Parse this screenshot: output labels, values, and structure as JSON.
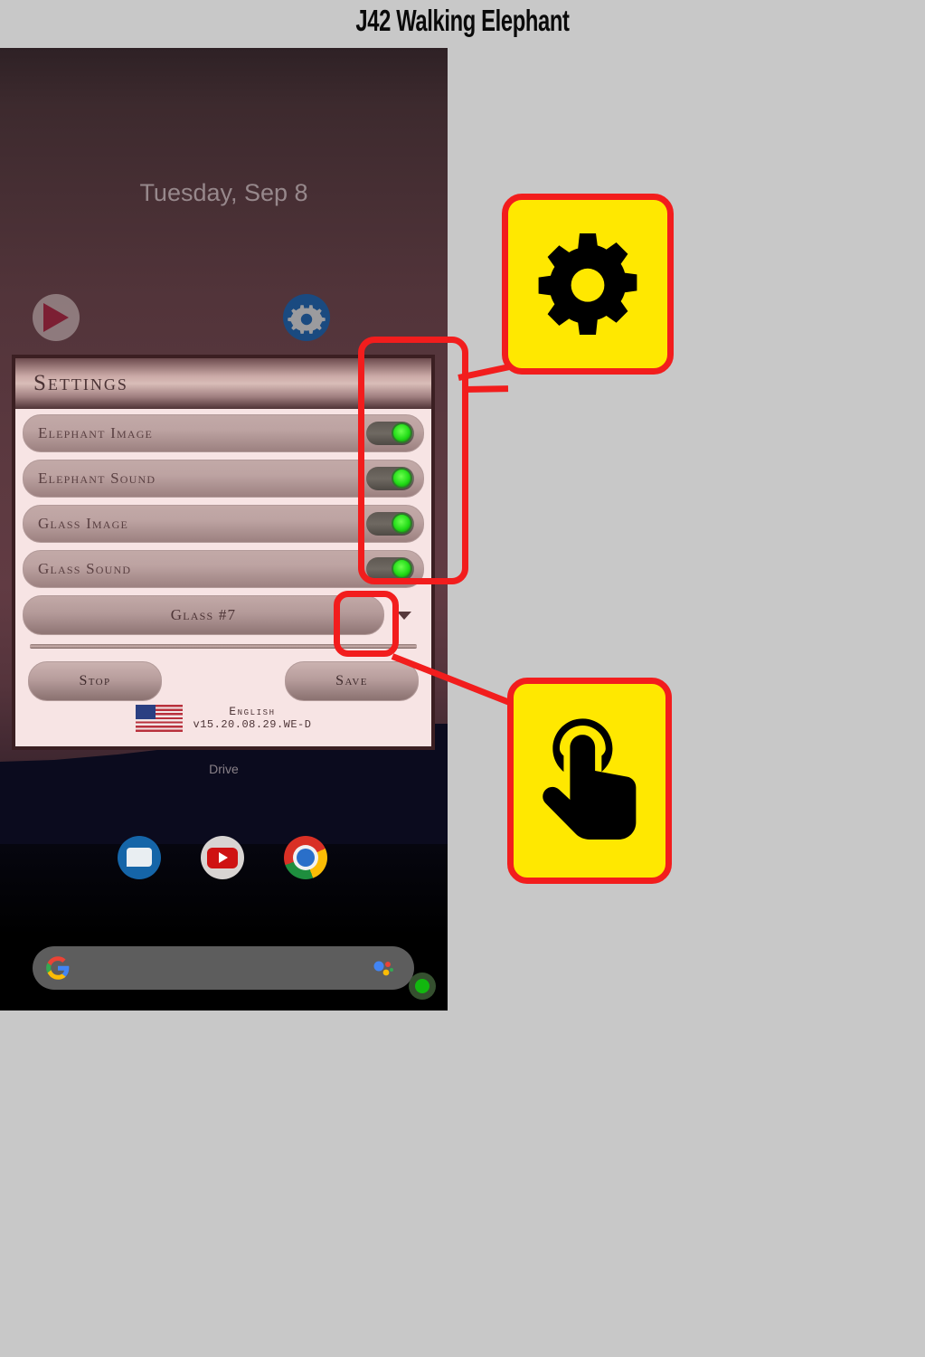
{
  "page": {
    "title": "J42 Walking Elephant",
    "background_color": "#c8c8c8",
    "accent_color": "#f21d1d",
    "callout_fill": "#ffe800"
  },
  "phone": {
    "home_screen": {
      "date": "Tuesday, Sep 8",
      "folder_label": "Drive",
      "icons": [
        {
          "name": "play-movies-icon",
          "label": ""
        },
        {
          "name": "settings-gear-icon",
          "label": ""
        }
      ],
      "dock": [
        {
          "name": "messages-icon"
        },
        {
          "name": "youtube-icon"
        },
        {
          "name": "chrome-icon"
        }
      ],
      "search": {
        "placeholder": "",
        "logo": "google-g-icon",
        "assistant": "assistant-mic-icon"
      },
      "status_dot_color": "#12b80f",
      "nav_bar": [
        {
          "name": "nav-back-button"
        },
        {
          "name": "nav-home-button"
        },
        {
          "name": "nav-recents-button"
        }
      ]
    }
  },
  "settings": {
    "title": "Settings",
    "rows": [
      {
        "label": "Elephant Image",
        "toggle": "on"
      },
      {
        "label": "Elephant Sound",
        "toggle": "on"
      },
      {
        "label": "Glass Image",
        "toggle": "on"
      },
      {
        "label": "Glass Sound",
        "toggle": "on"
      }
    ],
    "dropdown": {
      "value": "Glass #7",
      "caret": "chevron-down-icon"
    },
    "buttons": {
      "stop": "Stop",
      "save": "Save"
    },
    "footer": {
      "flag": "us-flag-icon",
      "language": "English",
      "version": "v15.20.08.29.WE-D"
    }
  },
  "annotations": {
    "gear_callout": {
      "icon": "gear-icon",
      "target": "toggle-column-highlight"
    },
    "tap_callout": {
      "icon": "tap-gesture-icon",
      "target": "save-button-highlight"
    }
  }
}
